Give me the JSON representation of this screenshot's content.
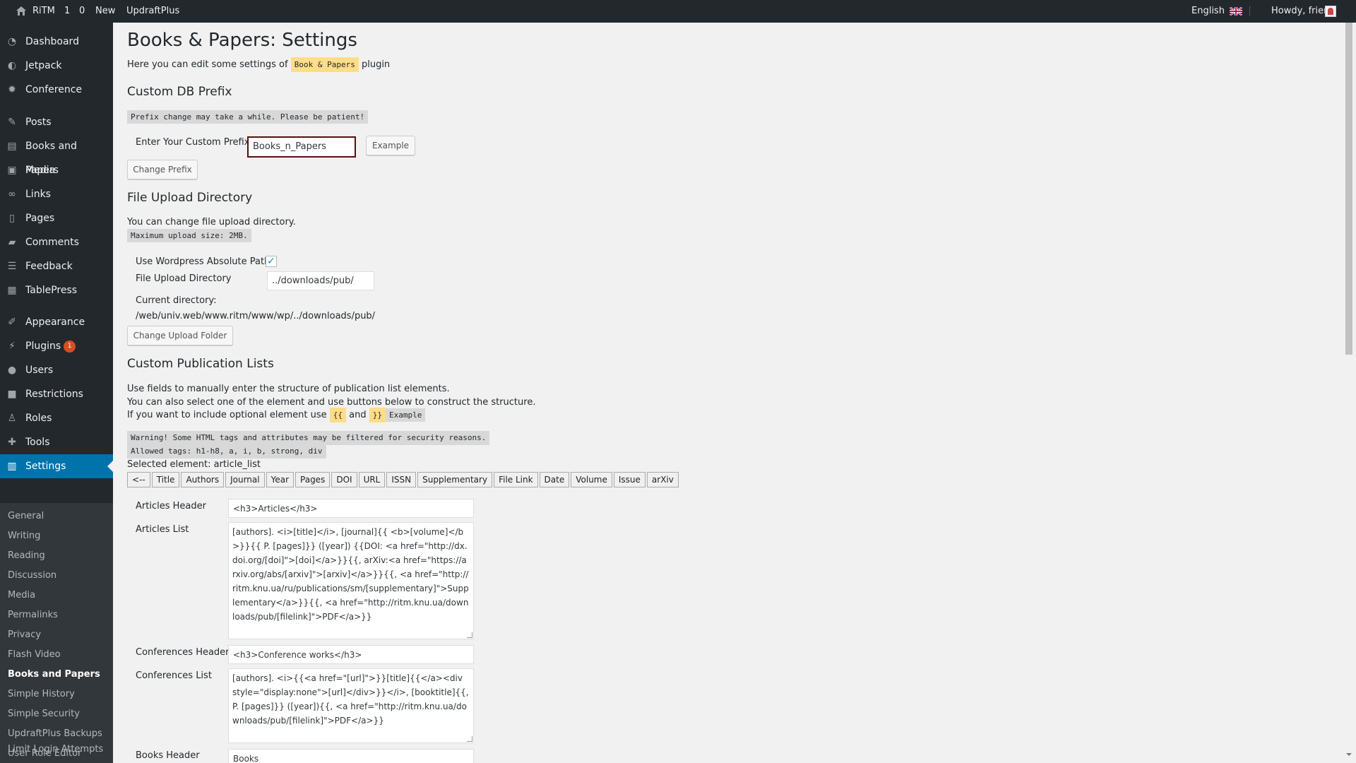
{
  "adminbar": {
    "site_name": "RiTM",
    "updates_count": "1",
    "comments_count": "0",
    "new_label": "New",
    "updraft_label": "UpdraftPlus",
    "language_label": "English",
    "howdy_label": "Howdy, frier"
  },
  "sidebar": {
    "items": [
      {
        "label": "Dashboard",
        "icon": "dashboard-icon"
      },
      {
        "label": "Jetpack",
        "icon": "jetpack-icon"
      },
      {
        "label": "Conference",
        "icon": "gear-icon"
      },
      {
        "label": "Posts",
        "icon": "pin-icon"
      },
      {
        "label": "Books and Papers",
        "icon": "book-icon"
      },
      {
        "label": "Media",
        "icon": "media-icon"
      },
      {
        "label": "Links",
        "icon": "link-icon"
      },
      {
        "label": "Pages",
        "icon": "page-icon"
      },
      {
        "label": "Comments",
        "icon": "comment-icon"
      },
      {
        "label": "Feedback",
        "icon": "feedback-icon"
      },
      {
        "label": "TablePress",
        "icon": "table-icon"
      },
      {
        "label": "Appearance",
        "icon": "brush-icon"
      },
      {
        "label": "Plugins",
        "icon": "plugin-icon",
        "badge": "1"
      },
      {
        "label": "Users",
        "icon": "user-icon"
      },
      {
        "label": "Restrictions",
        "icon": "lock-icon"
      },
      {
        "label": "Roles",
        "icon": "role-icon"
      },
      {
        "label": "Tools",
        "icon": "wrench-icon"
      },
      {
        "label": "Settings",
        "icon": "settings-icon"
      }
    ],
    "submenu": [
      "General",
      "Writing",
      "Reading",
      "Discussion",
      "Media",
      "Permalinks",
      "Privacy",
      "Flash Video",
      "Books and Papers",
      "Simple History",
      "Simple Security",
      "UpdraftPlus Backups",
      "User Role Editor",
      "Limit Login Attempts"
    ]
  },
  "page": {
    "title": "Books & Papers: Settings",
    "intro_prefix": "Here you can edit some settings of",
    "intro_code": "Book & Papers",
    "intro_suffix": "plugin"
  },
  "db_prefix": {
    "heading": "Custom DB Prefix",
    "notice": "Prefix change may take a while. Please be patient!",
    "label": "Enter Your Custom Prefix",
    "value": "Books_n_Papers",
    "example_button": "Example",
    "change_button": "Change Prefix"
  },
  "upload": {
    "heading": "File Upload Directory",
    "desc": "You can change file upload directory.",
    "max_size": "Maximum upload size: 2MB.",
    "abs_path_label": "Use Wordpress Absolute Path",
    "abs_path_checked": "✓",
    "dir_label": "File Upload Directory",
    "dir_value": "../downloads/pub/",
    "current_label": "Current directory:",
    "current_value": "/web/univ.web/www.ritm/www/wp/../downloads/pub/",
    "change_button": "Change Upload Folder"
  },
  "pub_lists": {
    "heading": "Custom Publication Lists",
    "line1": "Use fields to manually enter the structure of publication list elements.",
    "line2": "You can also select one of the element and use buttons below to construct the structure.",
    "line3_prefix": "If you want to include optional element use",
    "open_brace": "{{",
    "and": "and",
    "close_brace": "}}",
    "example_link": "Example",
    "warning1": "Warning! Some HTML tags and attributes may be filtered for security reasons.",
    "warning2": "Allowed tags: h1-h8, a, i, b, strong, div",
    "selected_element": "Selected element: article_list",
    "tag_buttons": [
      "<--",
      "Title",
      "Authors",
      "Journal",
      "Year",
      "Pages",
      "DOI",
      "URL",
      "ISSN",
      "Supplementary",
      "File Link",
      "Date",
      "Volume",
      "Issue",
      "arXiv"
    ],
    "articles_header_label": "Articles Header",
    "articles_header_value": "<h3>Articles</h3>",
    "articles_list_label": "Articles List",
    "articles_list_value": "[authors]. <i>[title]</i>, [journal]{{ <b>[volume]</b>}}{{ P. [pages]}} ([year]) {{DOI: <a href=\"http://dx.doi.org/[doi]\">[doi]</a>}}{{, arXiv:<a href=\"https://arxiv.org/abs/[arxiv]\">[arxiv]</a>}}{{, <a href=\"http://ritm.knu.ua/ru/publications/sm/[supplementary]\">Supplementary</a>}}{{, <a href=\"http://ritm.knu.ua/downloads/pub/[filelink]\">PDF</a>}}",
    "conf_header_label": "Conferences Header",
    "conf_header_value": "<h3>Conference works</h3>",
    "conf_list_label": "Conferences List",
    "conf_list_value": "[authors]. <i>{{<a href=\"[url]\">}}[title]{{</a><div style=\"display:none\">[url]</div>}}</i>, [booktitle]{{, P. [pages]}} ([year]){{, <a href=\"http://ritm.knu.ua/downloads/pub/[filelink]\">PDF</a>}}",
    "books_header_label": "Books Header",
    "books_header_value": "Books"
  }
}
